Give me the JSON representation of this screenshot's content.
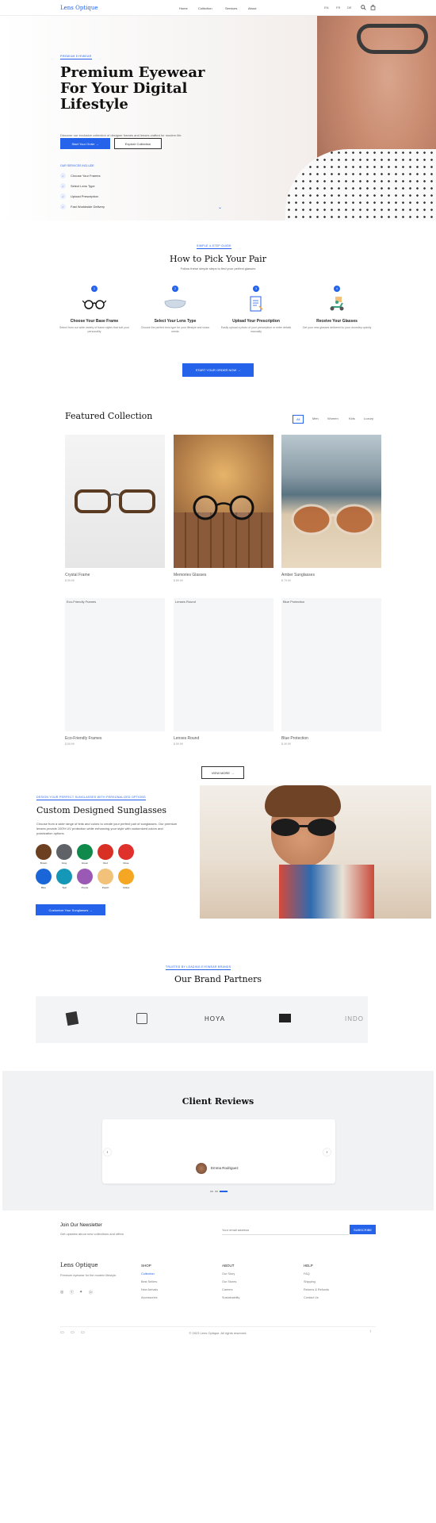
{
  "header": {
    "logo": "Lens Optique",
    "nav": [
      "Home",
      "Collection",
      "Services",
      "About"
    ],
    "lang": [
      "EN",
      "FR",
      "DE"
    ]
  },
  "hero": {
    "eyebrow": "PREMIUM EYEWEAR",
    "title": "Premium Eyewear For Your Digital Lifestyle",
    "desc": "Discover our exclusive collection of designer frames and lenses crafted for modern life.",
    "cta_primary": "Start Your Order →",
    "cta_secondary": "Explore Collection",
    "features_title": "OUR SERVICES INCLUDE",
    "features": [
      "Choose Your Frames",
      "Select Lens Type",
      "Upload Prescription",
      "Fast Worldwide Delivery"
    ]
  },
  "how": {
    "eyebrow": "SIMPLE 4-STEP GUIDE",
    "title": "How to Pick Your Pair",
    "subtitle": "Follow these simple steps to find your perfect glasses",
    "steps": [
      {
        "num": "1",
        "title": "Choose Your Base Frame",
        "desc": "Select from our wide variety of frame styles that suit your personality"
      },
      {
        "num": "2",
        "title": "Select Your Lens Type",
        "desc": "Choose the perfect lens type for your lifestyle and vision needs"
      },
      {
        "num": "3",
        "title": "Upload Your Prescription",
        "desc": "Easily upload a photo of your prescription or enter details manually"
      },
      {
        "num": "4",
        "title": "Receive Your Glasses",
        "desc": "Get your new glasses delivered to your doorstep quickly"
      }
    ],
    "cta": "START YOUR ORDER NOW →"
  },
  "featured": {
    "title": "Featured Collection",
    "tabs": [
      "All",
      "Men",
      "Women",
      "Kids",
      "Luxury"
    ],
    "items": [
      {
        "name": "Crystal Frame",
        "price": "$ 99.99",
        "badge": ""
      },
      {
        "name": "Memories Glasses",
        "price": "$ 89.99",
        "badge": ""
      },
      {
        "name": "Amber Sunglasses",
        "price": "$ 79.99",
        "badge": ""
      },
      {
        "name": "Eco-Friendly Frames",
        "price": "$ 69.99",
        "badge": "Eco-Friendly Frames"
      },
      {
        "name": "Lenses Round",
        "price": "$ 59.99",
        "badge": "Lenses Round"
      },
      {
        "name": "Blue Protection",
        "price": "$ 49.99",
        "badge": "Blue Protection"
      }
    ],
    "view_more": "VIEW MORE →"
  },
  "custom": {
    "eyebrow": "DESIGN YOUR PERFECT SUNGLASSES WITH PERSONALIZED OPTIONS",
    "title": "Custom Designed Sunglasses",
    "desc": "Choose from a wide range of tints and colors to create your perfect pair of sunglasses. Our premium lenses provide 100% UV protection while enhancing your style with customized colors and polarization options.",
    "swatches": [
      {
        "label": "Brown",
        "color": "#6b3f1f"
      },
      {
        "label": "Gray",
        "color": "#5f6368"
      },
      {
        "label": "Green",
        "color": "#0f8a4a"
      },
      {
        "label": "Red",
        "color": "#d93025"
      },
      {
        "label": "Rose",
        "color": "#e0302b"
      },
      {
        "label": "Blue",
        "color": "#1a66d8"
      },
      {
        "label": "Teal",
        "color": "#1597b8"
      },
      {
        "label": "Purple",
        "color": "#9b59b6"
      },
      {
        "label": "Peach",
        "color": "#f2c27a"
      },
      {
        "label": "Yellow",
        "color": "#f5a623"
      }
    ],
    "cta": "Customize Your Sunglasses →"
  },
  "brands": {
    "eyebrow": "TRUSTED BY LEADING EYEWEAR BRANDS",
    "title": "Our Brand Partners",
    "logos": [
      "Logo A",
      "Logo B",
      "HOYA",
      "Logo D",
      "INDO"
    ]
  },
  "reviews": {
    "title": "Client Reviews",
    "reviewer": "Emma Rodriguez"
  },
  "newsletter": {
    "title": "Join Our Newsletter",
    "desc": "Get updates about new collections and offers",
    "placeholder": "Your email address",
    "button": "SUBSCRIBE"
  },
  "footer": {
    "brand": "Lens Optique",
    "brand_desc": "Premium eyewear for the modern lifestyle.",
    "cols": [
      {
        "title": "SHOP",
        "links": [
          "Collection",
          "Best Sellers",
          "New Arrivals",
          "Accessories"
        ]
      },
      {
        "title": "ABOUT",
        "links": [
          "Our Story",
          "Our Stores",
          "Careers",
          "Sustainability"
        ]
      },
      {
        "title": "HELP",
        "links": [
          "FAQ",
          "Shipping",
          "Returns & Refunds",
          "Contact Us"
        ]
      }
    ],
    "copyright": "© 2023 Lens Optique. All rights reserved."
  },
  "colors": {
    "accent": "#2563eb"
  }
}
